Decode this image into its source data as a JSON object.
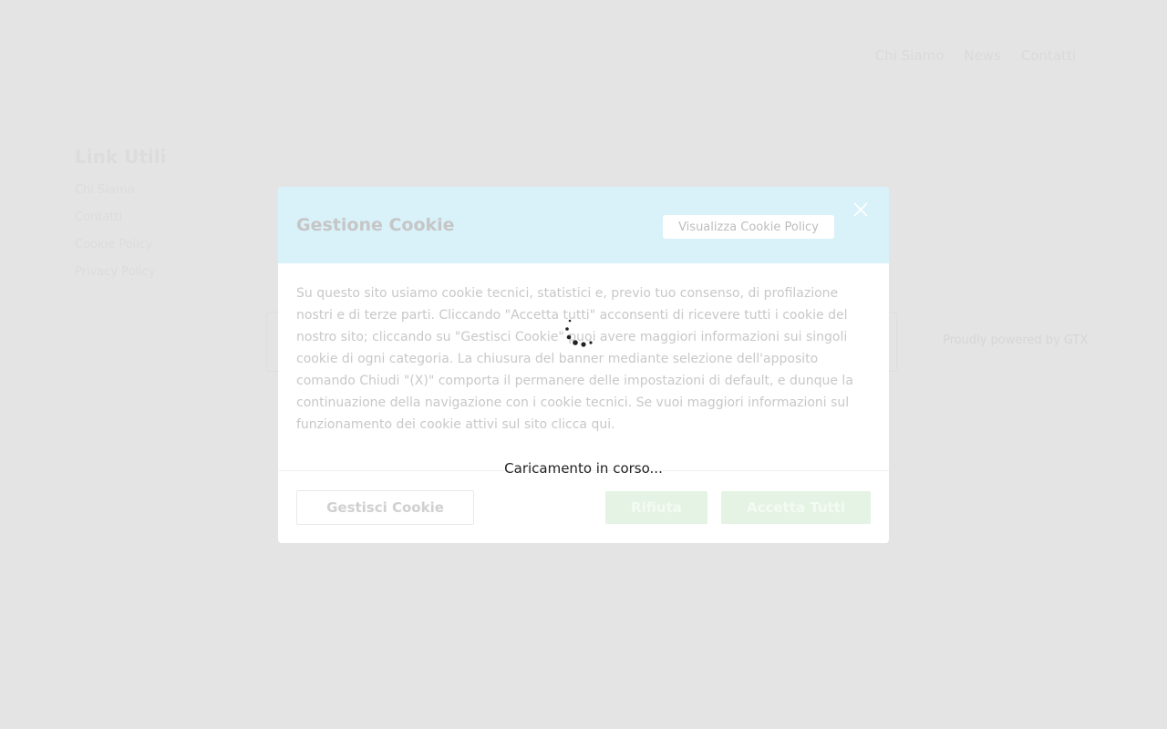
{
  "background": {
    "nav": [
      "Chi Siamo",
      "News",
      "Contatti"
    ],
    "links_title": "Link Utili",
    "links": [
      "Chi Siamo",
      "Contatti",
      "Cookie Policy",
      "Privacy Policy"
    ],
    "powered": "Proudly powered by GTX"
  },
  "modal": {
    "title": "Gestione Cookie",
    "policy_button": "Visualizza Cookie Policy",
    "body": "Su questo sito usiamo cookie tecnici, statistici e, previo tuo consenso, di profilazione nostri e di terze parti. Cliccando \"Accetta tutti\" acconsenti di ricevere tutti i cookie del nostro sito; cliccando su \"Gestisci Cookie\" puoi avere maggiori informazioni sui singoli cookie di ogni categoria. La chiusura del banner mediante selezione dell'apposito comando Chiudi \"(X)\" comporta il permanere delle impostazioni di default, e dunque la continuazione della navigazione con i cookie tecnici. Se vuoi maggiori informazioni sul funzionamento dei cookie attivi sul sito clicca qui.",
    "manage_button": "Gestisci Cookie",
    "reject_button": "Rifiuta",
    "accept_button": "Accetta Tutti"
  },
  "loading": {
    "text": "Caricamento in corso..."
  },
  "colors": {
    "header_bg": "#d9f1f9",
    "accept_bg": "#e4f3e4",
    "overlay_bg": "#e4e4e4"
  }
}
